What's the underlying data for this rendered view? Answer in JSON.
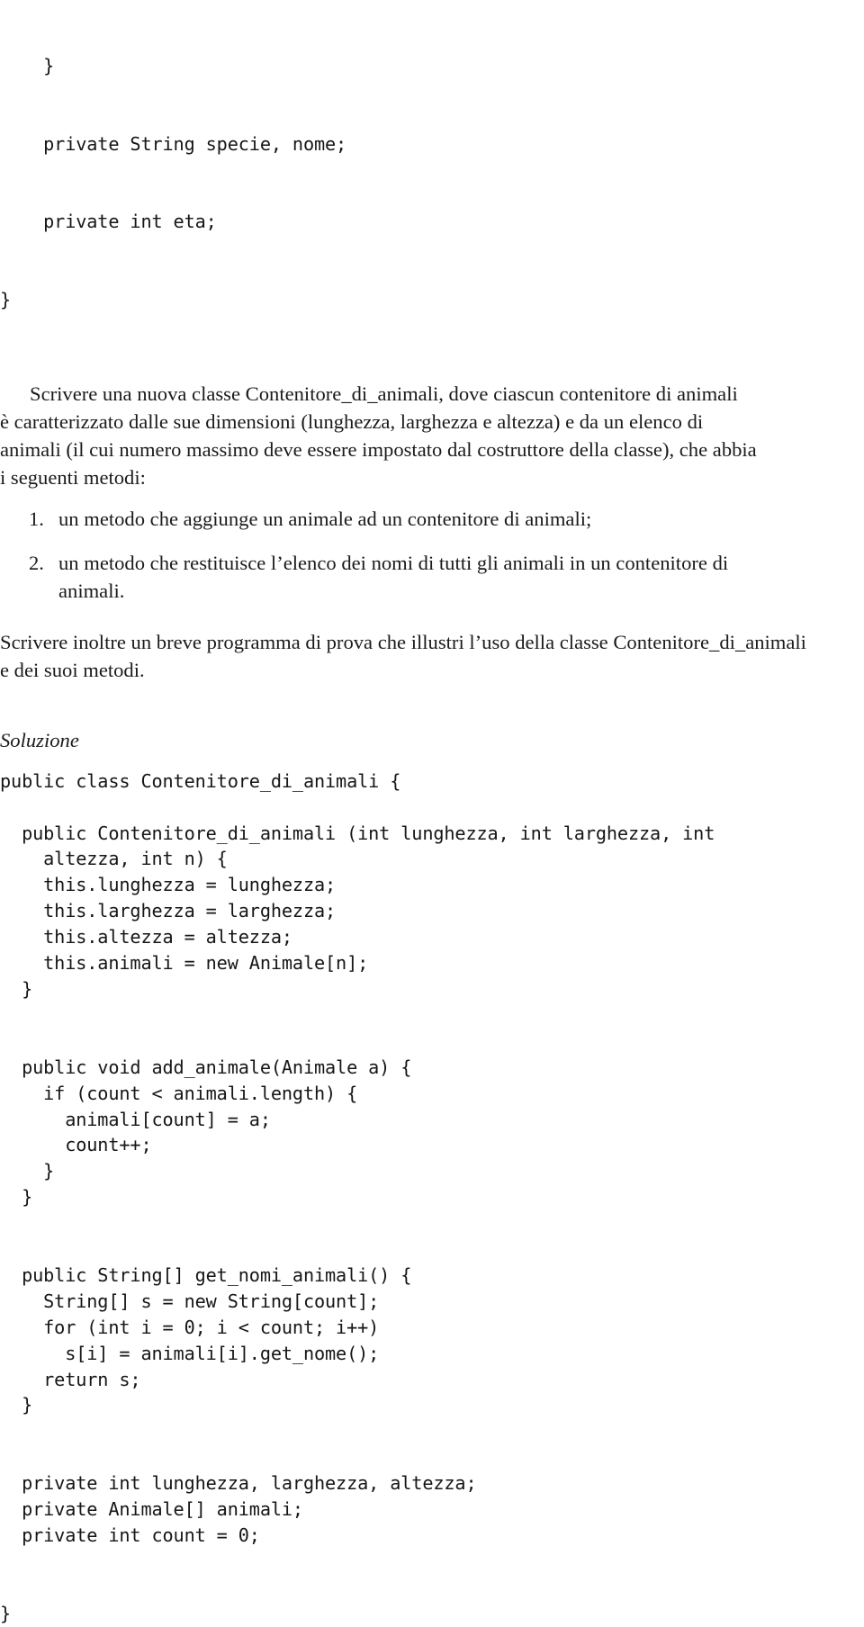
{
  "document": {
    "language": "it",
    "title": "Contenitore_di_animali",
    "background_color": "#ffffff",
    "text_color": "#1a1a1a"
  },
  "top_listing": {
    "lines": [
      "    }",
      "    private String specie, nome;",
      "    private int eta;",
      "}"
    ]
  },
  "paragraphs": {
    "intro_lines": [
      "Scrivere una nuova classe Contenitore_di_animali, dove ciascun contenitore di animali",
      "è caratterizzato dalle sue dimensioni (lunghezza, larghezza e altezza) e da un elenco di",
      "animali (il cui numero massimo deve essere impostato dal costruttore della classe), che abbia",
      "i seguenti metodi:"
    ],
    "intro_full": "Scrivere una nuova classe Contenitore_di_animali, dove ciascun contenitore di animali è caratterizzato dalle sue dimensioni (lunghezza, larghezza e altezza) e da un elenco di animali (il cui numero massimo deve essere impostato dal costruttore della classe), che abbia i seguenti metodi:",
    "closing_lines": [
      "Scrivere inoltre un breve programma di prova che illustri l’uso della classe Contenitore_di_animali",
      "e dei suoi metodi."
    ]
  },
  "enumerated_list": [
    {
      "number": "1.",
      "text": "un metodo che aggiunge un animale ad un contenitore di animali;"
    },
    {
      "number": "2.",
      "text": "un metodo che restituisce l’elenco dei nomi di tutti gli animali in un contenitore di",
      "continuation": "animali."
    }
  ],
  "solution_heading": "Soluzione",
  "solution_code": {
    "lines": [
      "public class Contenitore_di_animali {",
      "",
      "  public Contenitore_di_animali (int lunghezza, int larghezza, int",
      "    altezza, int n) {",
      "    this.lunghezza = lunghezza;",
      "    this.larghezza = larghezza;",
      "    this.altezza = altezza;",
      "    this.animali = new Animale[n];",
      "  }",
      "",
      "",
      "  public void add_animale(Animale a) {",
      "    if (count < animali.length) {",
      "      animali[count] = a;",
      "      count++;",
      "    }",
      "  }",
      "",
      "",
      "  public String[] get_nomi_animali() {",
      "    String[] s = new String[count];",
      "    for (int i = 0; i < count; i++)",
      "      s[i] = animali[i].get_nome();",
      "    return s;",
      "  }",
      "",
      "",
      "  private int lunghezza, larghezza, altezza;",
      "  private Animale[] animali;",
      "  private int count = 0;",
      "",
      "",
      "}"
    ]
  }
}
